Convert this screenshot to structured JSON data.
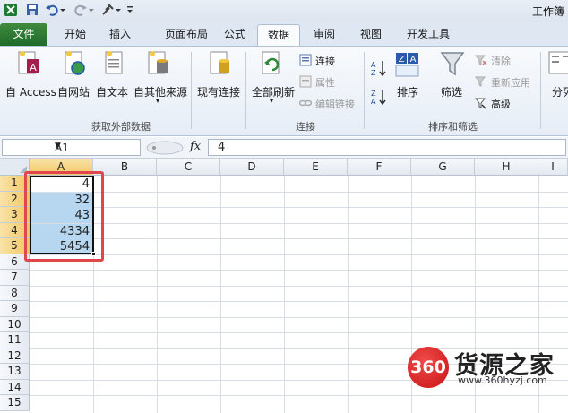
{
  "window": {
    "title": "工作簿"
  },
  "qat": {
    "icons": [
      "excel-logo-icon",
      "save-icon",
      "undo-icon",
      "redo-icon",
      "tools-icon",
      "customize-icon"
    ]
  },
  "tabs": [
    {
      "label": "文件"
    },
    {
      "label": "开始"
    },
    {
      "label": "插入"
    },
    {
      "label": "页面布局"
    },
    {
      "label": "公式"
    },
    {
      "label": "数据",
      "active": true
    },
    {
      "label": "审阅"
    },
    {
      "label": "视图"
    },
    {
      "label": "开发工具"
    }
  ],
  "ribbon": {
    "get_external": {
      "label": "获取外部数据",
      "buttons": [
        "自 Access",
        "自网站",
        "自文本",
        "自其他来源"
      ]
    },
    "existing": {
      "label": "现有连接"
    },
    "connections": {
      "label": "连接",
      "refresh_all": "全部刷新",
      "connections_btn": "连接",
      "properties_btn": "属性",
      "edit_links_btn": "编辑链接"
    },
    "sort_filter": {
      "label": "排序和筛选",
      "sort": "排序",
      "filter": "筛选",
      "clear": "清除",
      "reapply": "重新应用",
      "advanced": "高级"
    },
    "split": {
      "label": "分列"
    }
  },
  "formula_bar": {
    "name_box": "A1",
    "fx": "fx",
    "content": "4"
  },
  "sheet": {
    "columns": [
      "A",
      "B",
      "C",
      "D",
      "E",
      "F",
      "G",
      "H",
      "I"
    ],
    "selected_column": "A",
    "rows": [
      "1",
      "2",
      "3",
      "4",
      "5",
      "6",
      "7",
      "8",
      "9",
      "10",
      "11",
      "12",
      "13",
      "14",
      "15"
    ],
    "selected_rows": [
      "1",
      "2",
      "3",
      "4",
      "5"
    ],
    "cells": [
      "4",
      "32",
      "43",
      "4334",
      "5454"
    ],
    "selection": "A1:A5"
  },
  "watermark": {
    "badge": "360",
    "title": "货源之家",
    "url": "www.360hyzj.com"
  },
  "colors": {
    "file_tab": "#2b7a33",
    "selection_fill": "#b7d6ef",
    "highlight_box": "#e0474c",
    "header_selected": "#f1c867"
  }
}
